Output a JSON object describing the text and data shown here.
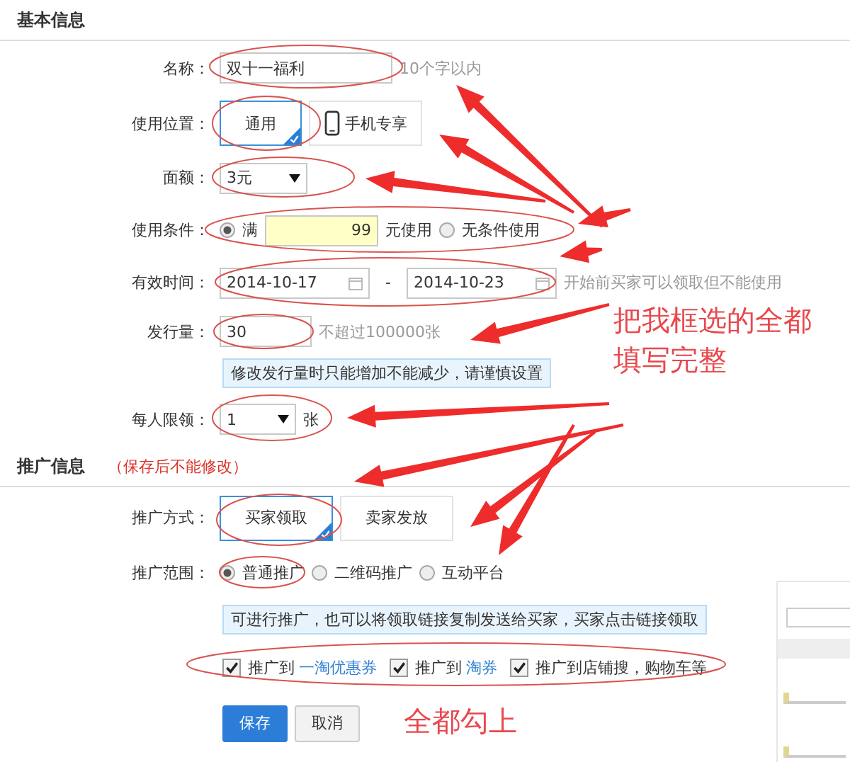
{
  "basic": {
    "title": "基本信息",
    "name": {
      "label": "名称：",
      "value": "双十一福利",
      "hint": "10个字以内"
    },
    "position": {
      "label": "使用位置：",
      "options": [
        {
          "label": "通用",
          "selected": true,
          "kind": "plain"
        },
        {
          "label": "手机专享",
          "selected": false,
          "kind": "phone"
        }
      ]
    },
    "face": {
      "label": "面额：",
      "value": "3元"
    },
    "condition": {
      "label": "使用条件：",
      "options": [
        {
          "label": "满",
          "selected": true,
          "amount": "99",
          "suffix": "元使用"
        },
        {
          "label": "无条件使用",
          "selected": false
        }
      ]
    },
    "validity": {
      "label": "有效时间：",
      "start": "2014-10-17",
      "separator": "-",
      "end": "2014-10-23",
      "hint": "开始前买家可以领取但不能使用"
    },
    "issue": {
      "label": "发行量：",
      "value": "30",
      "hint": "不超过100000张",
      "note": "修改发行量时只能增加不能减少，请谨慎设置"
    },
    "limit": {
      "label": "每人限领：",
      "value": "1",
      "unit": "张"
    }
  },
  "promo": {
    "title": "推广信息",
    "warning": "（保存后不能修改）",
    "method": {
      "label": "推广方式：",
      "options": [
        {
          "label": "买家领取",
          "selected": true
        },
        {
          "label": "卖家发放",
          "selected": false
        }
      ]
    },
    "scope": {
      "label": "推广范围：",
      "options": [
        {
          "label": "普通推广",
          "selected": true
        },
        {
          "label": "二维码推广",
          "selected": false
        },
        {
          "label": "互动平台",
          "selected": false
        }
      ]
    },
    "info": "可进行推广，也可以将领取链接复制发送给买家，买家点击链接领取",
    "channels": [
      {
        "text": "推广到",
        "link": "一淘优惠券",
        "checked": true
      },
      {
        "text": "推广到",
        "link": "淘券",
        "checked": true
      },
      {
        "text": "推广到店铺搜，购物车等",
        "checked": true
      }
    ],
    "buttons": [
      {
        "label": "保存",
        "kind": "primary"
      },
      {
        "label": "取消",
        "kind": "default"
      }
    ]
  },
  "annotations": [
    {
      "text": "把我框选的全都填写完整",
      "kind": "big"
    },
    {
      "text": "全都勾上",
      "kind": "small"
    }
  ]
}
